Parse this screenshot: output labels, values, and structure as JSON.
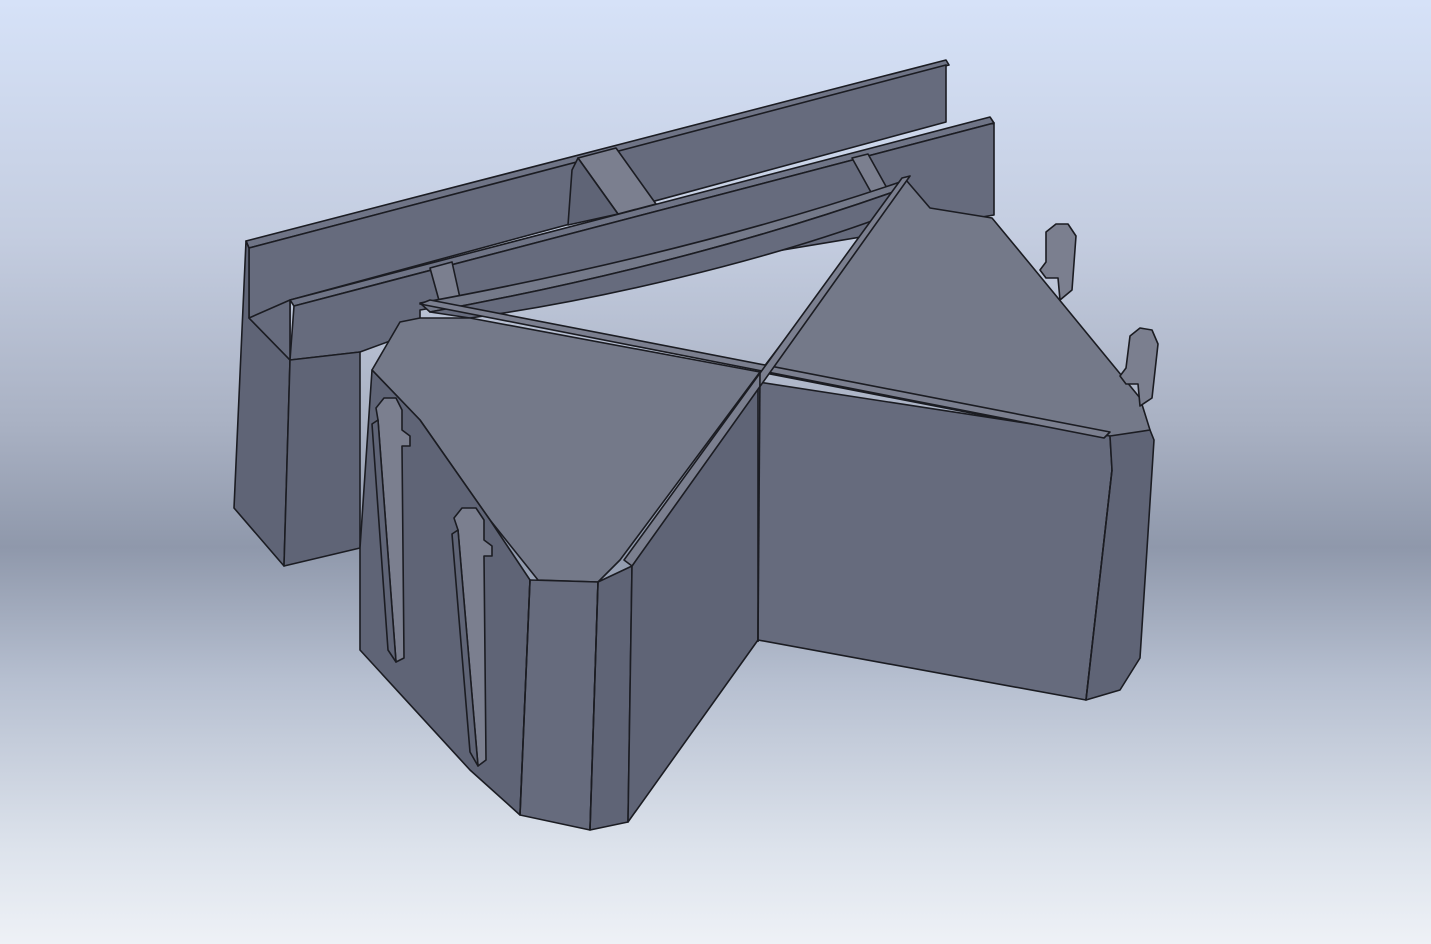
{
  "viewport": {
    "background_top": "#d6e2f8",
    "background_mid": "#8f98ab",
    "background_bottom": "#eef1f6",
    "model_color": "#6a6f81",
    "edge_color": "#1b1c22"
  },
  "model": {
    "name_icon": "solid-part-icon"
  }
}
